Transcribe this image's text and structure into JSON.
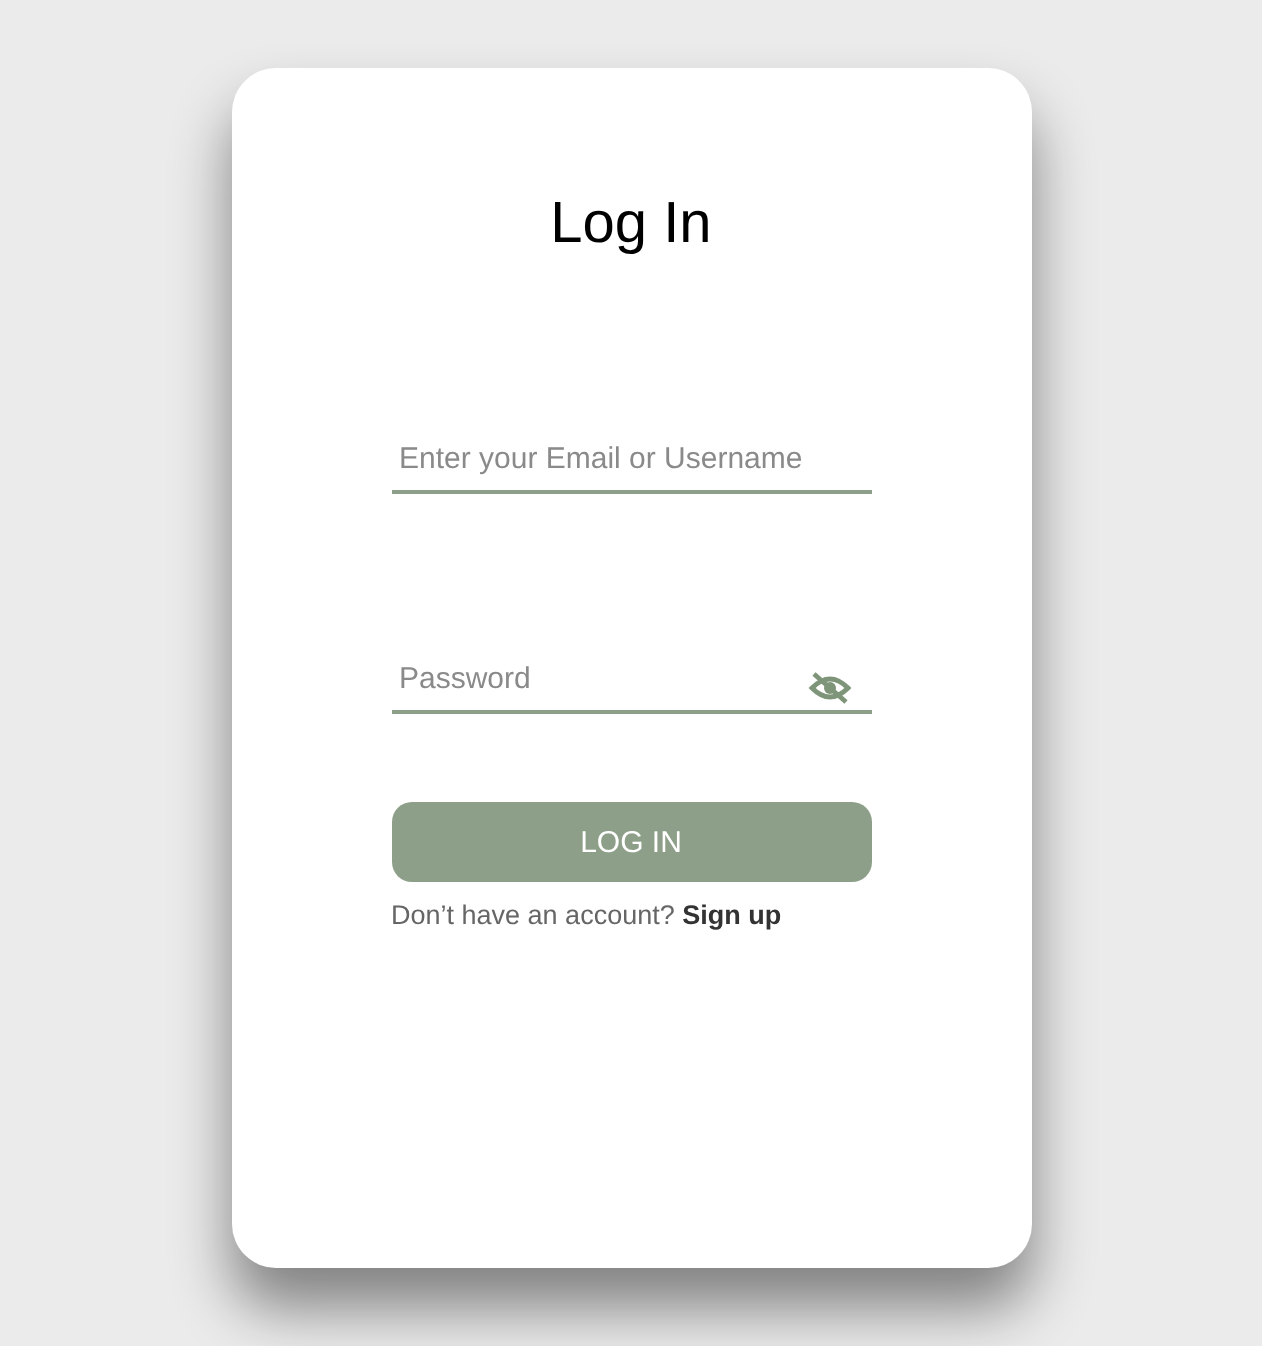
{
  "title": "Log In",
  "fields": [
    {
      "placeholder": "Enter your Email or Username",
      "kind": "text"
    },
    {
      "placeholder": "Password",
      "kind": "password"
    }
  ],
  "button": "LOG IN",
  "signup": {
    "prompt": "Don’t have an account?",
    "link": "Sign up"
  }
}
